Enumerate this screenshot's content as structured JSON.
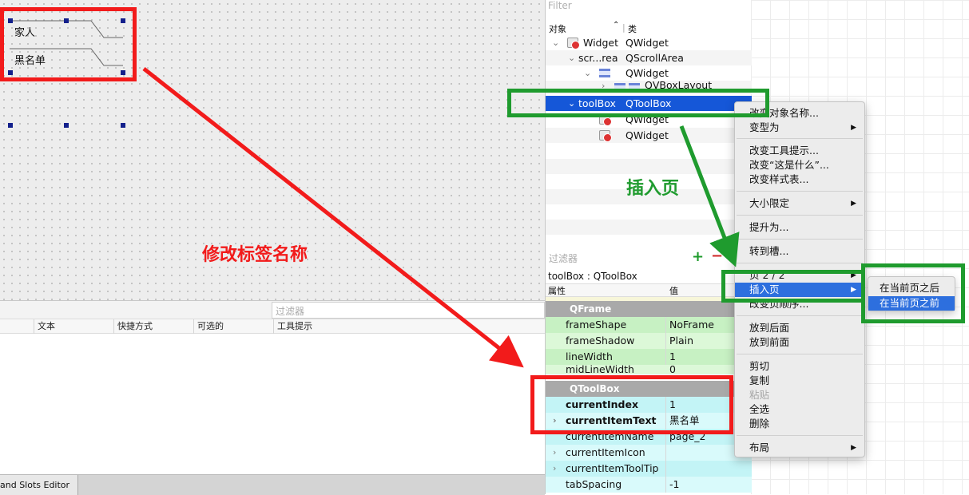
{
  "canvas": {
    "toolbox_items": [
      "家人",
      "黑名单"
    ]
  },
  "action_editor": {
    "filter_placeholder": "过滤器",
    "columns": [
      "文本",
      "快捷方式",
      "可选的",
      "工具提示"
    ],
    "bottom_tab": "and Slots Editor"
  },
  "object_inspector": {
    "filter_placeholder": "Filter",
    "col_object": "对象",
    "col_class": "类",
    "rows": [
      {
        "name": "Widget",
        "cls": "QWidget"
      },
      {
        "name": "scr...rea",
        "cls": "QScrollArea"
      },
      {
        "name": "",
        "cls": "QWidget"
      },
      {
        "name": "",
        "cls": "QVBoxLayout"
      },
      {
        "name": "toolBox",
        "cls": "QToolBox"
      },
      {
        "name": "",
        "cls": "QWidget"
      },
      {
        "name": "",
        "cls": "QWidget"
      }
    ]
  },
  "property_editor": {
    "filter_placeholder": "过滤器",
    "title": "toolBox : QToolBox",
    "col_property": "属性",
    "col_value": "值",
    "groups": {
      "qframe": "QFrame",
      "qtoolbox": "QToolBox"
    },
    "frame_props": [
      {
        "name": "frameShape",
        "value": "NoFrame"
      },
      {
        "name": "frameShadow",
        "value": "Plain"
      },
      {
        "name": "lineWidth",
        "value": "1"
      },
      {
        "name": "midLineWidth",
        "value": "0"
      }
    ],
    "toolbox_props": [
      {
        "name": "currentIndex",
        "value": "1"
      },
      {
        "name": "currentItemText",
        "value": "黑名单"
      },
      {
        "name": "currentItemName",
        "value": "page_2"
      },
      {
        "name": "currentItemIcon",
        "value": ""
      },
      {
        "name": "currentItemToolTip",
        "value": ""
      },
      {
        "name": "tabSpacing",
        "value": "-1"
      }
    ]
  },
  "context_menu": {
    "items": [
      "改变对象名称...",
      "变型为",
      "改变工具提示...",
      "改变“这是什么”...",
      "改变样式表...",
      "大小限定",
      "提升为...",
      "转到槽...",
      "页 2 / 2",
      "插入页",
      "改变页顺序...",
      "放到后面",
      "放到前面",
      "剪切",
      "复制",
      "粘贴",
      "全选",
      "删除",
      "布局"
    ]
  },
  "submenu": {
    "items": [
      "在当前页之后",
      "在当前页之前"
    ]
  },
  "annotations": {
    "rename_label": "修改标签名称",
    "insert_page": "插入页",
    "red": "#f21b1b",
    "green": "#1f9b2e"
  }
}
